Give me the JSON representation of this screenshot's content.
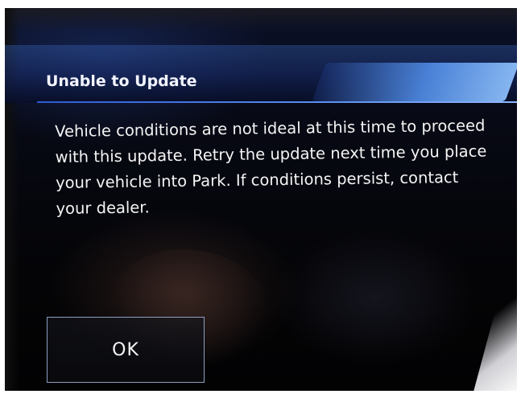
{
  "dialog": {
    "title": "Unable to Update",
    "message": "Vehicle conditions are not ideal at this time to proceed with this update. Retry the update next time you place your vehicle into Park. If conditions persist, contact your dealer.",
    "ok_label": "OK"
  },
  "colors": {
    "header_accent": "#2c5bd6",
    "text": "#f4f4f4",
    "background": "#040406",
    "button_border": "#8da0c0"
  }
}
